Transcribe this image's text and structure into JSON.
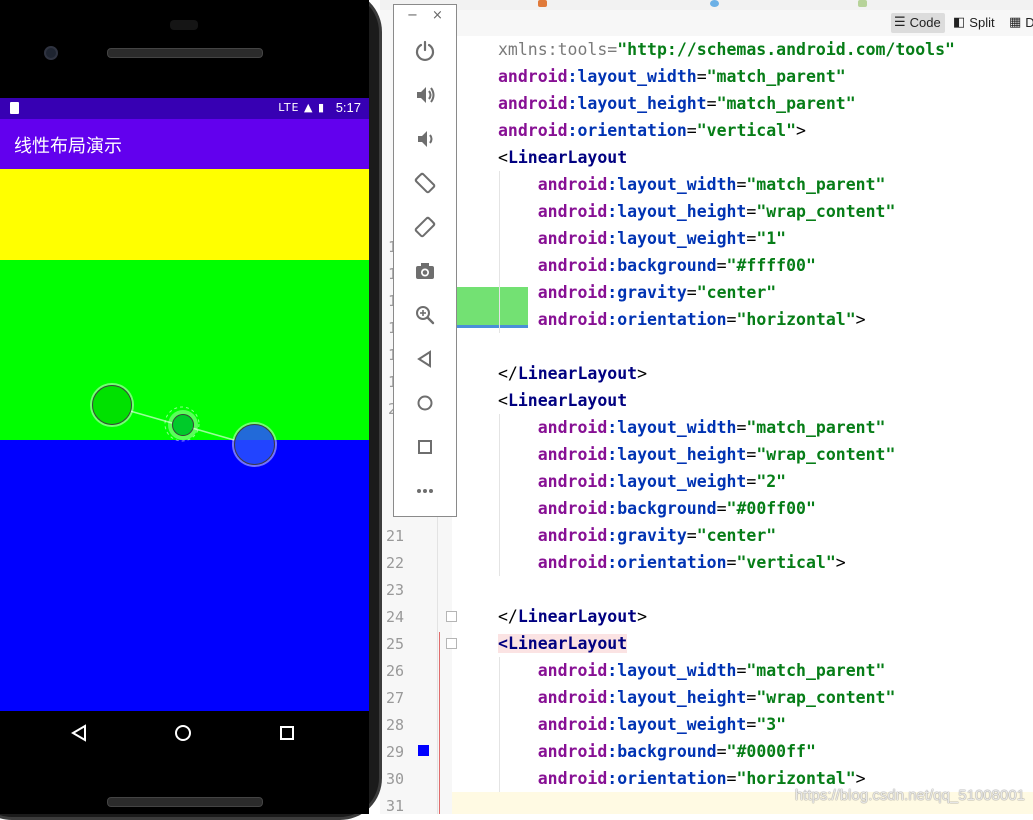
{
  "emulator": {
    "status_time": "5:17",
    "status_icons": "LTE ▲ ▮",
    "app_title": "线性布局演示",
    "colors": {
      "statusbar": "#3700b3",
      "appbar": "#6200ee",
      "region1": "#ffff00",
      "region2": "#00ff00",
      "region3": "#0000ff"
    },
    "nav_icons": [
      "back-icon",
      "home-icon",
      "recents-icon"
    ]
  },
  "toolbar": {
    "minimize_label": "−",
    "close_label": "×",
    "buttons": [
      "power-icon",
      "volume-up-icon",
      "volume-down-icon",
      "rotate-left-icon",
      "rotate-right-icon",
      "camera-icon",
      "zoom-icon",
      "back-icon",
      "home-icon",
      "overview-icon",
      "more-icon"
    ]
  },
  "ide": {
    "view_modes": {
      "code": "Code",
      "split": "Split",
      "design": "De"
    },
    "line_numbers": [
      "21",
      "22",
      "23",
      "24",
      "25",
      "26",
      "27",
      "28",
      "29",
      "30",
      "31"
    ],
    "partial_line_numbers": [
      "1",
      "1",
      "1",
      "1",
      "1",
      "1",
      "2"
    ],
    "code_lines": [
      [
        [
          "ns",
          "xmlns:tools"
        ],
        [
          "pl",
          "="
        ],
        [
          "st",
          "\"http://schemas.android.com/tools\""
        ]
      ],
      [
        [
          "ns",
          "android"
        ],
        [
          "an",
          ":layout_width"
        ],
        [
          "pl",
          "="
        ],
        [
          "st",
          "\"match_parent\""
        ]
      ],
      [
        [
          "ns",
          "android"
        ],
        [
          "an",
          ":layout_height"
        ],
        [
          "pl",
          "="
        ],
        [
          "st",
          "\"match_parent\""
        ]
      ],
      [
        [
          "ns",
          "android"
        ],
        [
          "an",
          ":orientation"
        ],
        [
          "pl",
          "="
        ],
        [
          "st",
          "\"vertical\""
        ],
        [
          "pl",
          ">"
        ]
      ],
      [
        [
          "pl",
          "<"
        ],
        [
          "tg",
          "LinearLayout"
        ]
      ],
      [
        [
          "pl",
          "    "
        ],
        [
          "ns",
          "android"
        ],
        [
          "an",
          ":layout_width"
        ],
        [
          "pl",
          "="
        ],
        [
          "st",
          "\"match_parent\""
        ]
      ],
      [
        [
          "pl",
          "    "
        ],
        [
          "ns",
          "android"
        ],
        [
          "an",
          ":layout_height"
        ],
        [
          "pl",
          "="
        ],
        [
          "st",
          "\"wrap_content\""
        ]
      ],
      [
        [
          "pl",
          "    "
        ],
        [
          "ns",
          "android"
        ],
        [
          "an",
          ":layout_weight"
        ],
        [
          "pl",
          "="
        ],
        [
          "st",
          "\"1\""
        ]
      ],
      [
        [
          "pl",
          "    "
        ],
        [
          "ns",
          "android"
        ],
        [
          "an",
          ":background"
        ],
        [
          "pl",
          "="
        ],
        [
          "st",
          "\"#ffff00\""
        ]
      ],
      [
        [
          "pl",
          "    "
        ],
        [
          "ns",
          "android"
        ],
        [
          "an",
          ":gravity"
        ],
        [
          "pl",
          "="
        ],
        [
          "st",
          "\"center\""
        ]
      ],
      [
        [
          "pl",
          "    "
        ],
        [
          "ns",
          "android"
        ],
        [
          "an",
          ":orientation"
        ],
        [
          "pl",
          "="
        ],
        [
          "st",
          "\"horizontal\""
        ],
        [
          "pl",
          ">"
        ]
      ],
      [
        [
          "pl",
          ""
        ]
      ],
      [
        [
          "pl",
          "</"
        ],
        [
          "tg",
          "LinearLayout"
        ],
        [
          "pl",
          ">"
        ]
      ],
      [
        [
          "pl",
          "<"
        ],
        [
          "tg",
          "LinearLayout"
        ]
      ],
      [
        [
          "pl",
          "    "
        ],
        [
          "ns",
          "android"
        ],
        [
          "an",
          ":layout_width"
        ],
        [
          "pl",
          "="
        ],
        [
          "st",
          "\"match_parent\""
        ]
      ],
      [
        [
          "pl",
          "    "
        ],
        [
          "ns",
          "android"
        ],
        [
          "an",
          ":layout_height"
        ],
        [
          "pl",
          "="
        ],
        [
          "st",
          "\"wrap_content\""
        ]
      ],
      [
        [
          "pl",
          "    "
        ],
        [
          "ns",
          "android"
        ],
        [
          "an",
          ":layout_weight"
        ],
        [
          "pl",
          "="
        ],
        [
          "st",
          "\"2\""
        ]
      ],
      [
        [
          "pl",
          "    "
        ],
        [
          "ns",
          "android"
        ],
        [
          "an",
          ":background"
        ],
        [
          "pl",
          "="
        ],
        [
          "st",
          "\"#00ff00\""
        ]
      ],
      [
        [
          "pl",
          "    "
        ],
        [
          "ns",
          "android"
        ],
        [
          "an",
          ":gravity"
        ],
        [
          "pl",
          "="
        ],
        [
          "st",
          "\"center\""
        ]
      ],
      [
        [
          "pl",
          "    "
        ],
        [
          "ns",
          "android"
        ],
        [
          "an",
          ":orientation"
        ],
        [
          "pl",
          "="
        ],
        [
          "st",
          "\"vertical\""
        ],
        [
          "pl",
          ">"
        ]
      ],
      [
        [
          "pl",
          ""
        ]
      ],
      [
        [
          "pl",
          "</"
        ],
        [
          "tg",
          "LinearLayout"
        ],
        [
          "pl",
          ">"
        ]
      ],
      [
        [
          "hl",
          "<"
        ],
        [
          "hlt",
          "LinearLayout"
        ]
      ],
      [
        [
          "pl",
          "    "
        ],
        [
          "ns",
          "android"
        ],
        [
          "an",
          ":layout_width"
        ],
        [
          "pl",
          "="
        ],
        [
          "st",
          "\"match_parent\""
        ]
      ],
      [
        [
          "pl",
          "    "
        ],
        [
          "ns",
          "android"
        ],
        [
          "an",
          ":layout_height"
        ],
        [
          "pl",
          "="
        ],
        [
          "st",
          "\"wrap_content\""
        ]
      ],
      [
        [
          "pl",
          "    "
        ],
        [
          "ns",
          "android"
        ],
        [
          "an",
          ":layout_weight"
        ],
        [
          "pl",
          "="
        ],
        [
          "st",
          "\"3\""
        ]
      ],
      [
        [
          "pl",
          "    "
        ],
        [
          "ns",
          "android"
        ],
        [
          "an",
          ":background"
        ],
        [
          "pl",
          "="
        ],
        [
          "st",
          "\"#0000ff\""
        ]
      ],
      [
        [
          "pl",
          "    "
        ],
        [
          "ns",
          "android"
        ],
        [
          "an",
          ":orientation"
        ],
        [
          "pl",
          "="
        ],
        [
          "st",
          "\"horizontal\""
        ],
        [
          "pl",
          ">"
        ]
      ]
    ],
    "watermark": "https://blog.csdn.net/qq_51008001"
  }
}
